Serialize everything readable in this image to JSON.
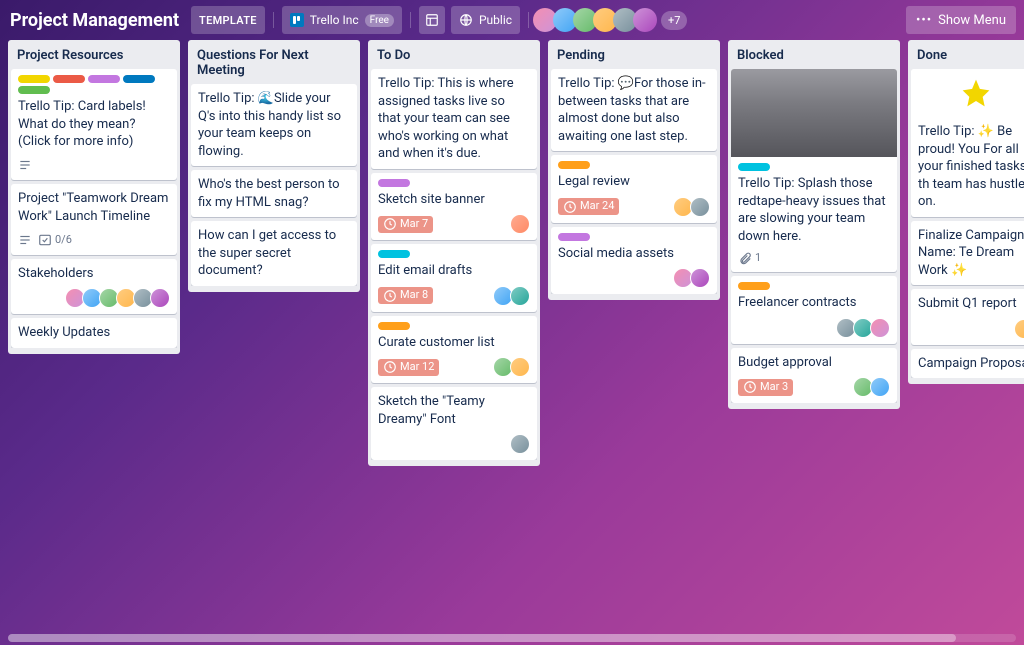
{
  "header": {
    "board_name": "Project Management",
    "template_chip": "TEMPLATE",
    "workspace": {
      "name": "Trello Inc",
      "pill": "Free"
    },
    "visibility": "Public",
    "avatar_overflow": "+7",
    "show_menu": "Show Menu"
  },
  "lists": [
    {
      "title": "Project Resources",
      "cards": [
        {
          "labels": [
            "yellow",
            "red",
            "purple",
            "blue",
            "green"
          ],
          "title": "Trello Tip: Card labels! What do they mean? (Click for more info)",
          "desc_icon": true
        },
        {
          "title": "Project \"Teamwork Dream Work\" Launch Timeline",
          "desc_icon": true,
          "checklist": "0/6"
        },
        {
          "title": "Stakeholders",
          "members": [
            "a",
            "b",
            "c",
            "d",
            "e",
            "f"
          ]
        },
        {
          "title": "Weekly Updates"
        }
      ]
    },
    {
      "title": "Questions For Next Meeting",
      "cards": [
        {
          "title": "Trello Tip: 🌊Slide your Q's into this handy list so your team keeps on flowing."
        },
        {
          "title": "Who's the best person to fix my HTML snag?"
        },
        {
          "title": "How can I get access to the super secret document?"
        }
      ]
    },
    {
      "title": "To Do",
      "cards": [
        {
          "title": "Trello Tip: This is where assigned tasks live so that your team can see who's working on what and when it's due."
        },
        {
          "labels": [
            "purple"
          ],
          "title": "Sketch site banner",
          "due": "Mar 7",
          "members": [
            "h"
          ]
        },
        {
          "labels": [
            "teal"
          ],
          "title": "Edit email drafts",
          "due": "Mar 8",
          "members": [
            "b",
            "g"
          ]
        },
        {
          "labels": [
            "orange"
          ],
          "title": "Curate customer list",
          "due": "Mar 12",
          "members": [
            "c",
            "d"
          ]
        },
        {
          "title": "Sketch the \"Teamy Dreamy\" Font",
          "members": [
            "e"
          ]
        }
      ]
    },
    {
      "title": "Pending",
      "cards": [
        {
          "title": "Trello Tip: 💬For those in-between tasks that are almost done but also awaiting one last step."
        },
        {
          "labels": [
            "orange"
          ],
          "title": "Legal review",
          "due": "Mar 24",
          "members": [
            "d",
            "e"
          ]
        },
        {
          "labels": [
            "purple"
          ],
          "title": "Social media assets",
          "members": [
            "a",
            "f"
          ]
        }
      ]
    },
    {
      "title": "Blocked",
      "cards": [
        {
          "cover": "darkcat",
          "labels": [
            "teal"
          ],
          "title": "Trello Tip: Splash those redtape-heavy issues that are slowing your team down here.",
          "attachment": "1"
        },
        {
          "labels": [
            "orange"
          ],
          "title": "Freelancer contracts",
          "members": [
            "e",
            "g",
            "a"
          ]
        },
        {
          "title": "Budget approval",
          "due": "Mar 3",
          "members": [
            "c",
            "b"
          ]
        }
      ]
    },
    {
      "title": "Done",
      "cards": [
        {
          "cover": "star",
          "title": "Trello Tip: ✨ Be proud! You For all your finished tasks th team has hustled on."
        },
        {
          "title": "Finalize Campaign Name: Te Dream Work ✨"
        },
        {
          "title": "Submit Q1 report",
          "members": [
            "d"
          ]
        },
        {
          "title": "Campaign Proposal"
        }
      ]
    }
  ]
}
